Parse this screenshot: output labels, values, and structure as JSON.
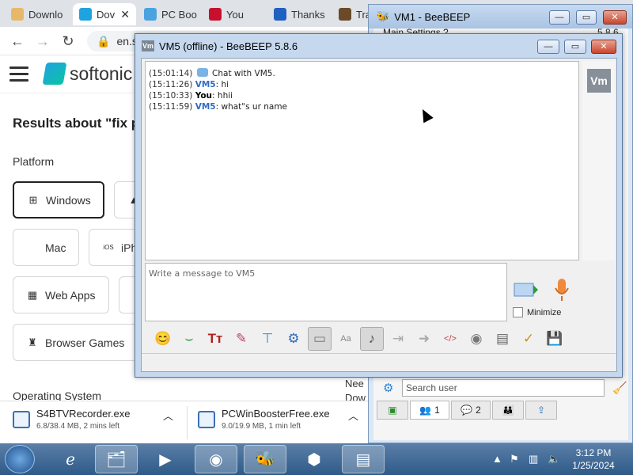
{
  "browser": {
    "tabs": [
      {
        "label": "Downlo",
        "icon": "softonic-icon",
        "color": "#e8b86a"
      },
      {
        "label": "Dov",
        "icon": "softonic-icon",
        "color": "#1fa3e0",
        "close": "✕"
      },
      {
        "label": "PC Boo",
        "icon": "pc-booster-icon",
        "color": "#4aa3df"
      },
      {
        "label": "You",
        "icon": "adobe-icon",
        "color": "#c8102e"
      },
      {
        "label": "Thanks",
        "icon": "thanks-icon",
        "color": "#2060c0"
      },
      {
        "label": "Tra",
        "icon": "game-icon",
        "color": "#6b4a2a"
      }
    ],
    "address": "en.so"
  },
  "page": {
    "brand": "softonic",
    "results_title": "Results about \"fix p",
    "platform_label": "Platform",
    "chips": [
      {
        "label": "Windows",
        "icon": "⊞"
      },
      {
        "label": "Mac",
        "icon": ""
      },
      {
        "label": "iPh",
        "icon": "iOS"
      },
      {
        "label": "Web Apps",
        "icon": "▦"
      },
      {
        "label": "Browser Games",
        "icon": "♜"
      }
    ],
    "os_label": "Operating System",
    "partial_text": [
      "Nee",
      "Dow"
    ]
  },
  "downloads": [
    {
      "name": "S4BTVRecorder.exe",
      "meta": "6.8/38.4 MB, 2 mins left"
    },
    {
      "name": "PCWinBoosterFree.exe",
      "meta": "9.0/19.9 MB, 1 min left"
    }
  ],
  "vm1": {
    "title": "VM1 - BeeBEEP",
    "search_placeholder": "Search user",
    "tabs": [
      {
        "label": "",
        "icon": "screen-icon"
      },
      {
        "label": "1",
        "icon": "users-icon"
      },
      {
        "label": "2",
        "icon": "chat-icon"
      },
      {
        "label": "",
        "icon": "groups-icon"
      },
      {
        "label": "",
        "icon": "share-icon"
      }
    ],
    "header_partial": "Main Settings ?",
    "version_partial": "5.8.6"
  },
  "vm5": {
    "title": "VM5 (offline) - BeeBEEP 5.8.6",
    "avatar": "Vm",
    "messages": [
      {
        "time": "(15:01:14)",
        "sender": "",
        "text": "Chat with VM5."
      },
      {
        "time": "(15:11:26)",
        "sender": "VM5",
        "text": "hi"
      },
      {
        "time": "(15:10:33)",
        "sender": "You",
        "text": "hhii"
      },
      {
        "time": "(15:11:59)",
        "sender": "VM5",
        "text": "what\"s ur name"
      }
    ],
    "input_placeholder": "Write a message to VM5",
    "minimize_label": "Minimize",
    "toolbar": [
      "😊",
      "⌣",
      "Tт",
      "✎",
      "⊤",
      "⚙",
      "▭",
      "Aa",
      "♪",
      "⇥",
      "➜",
      "</>",
      "◉",
      "▤",
      "✓",
      "💾"
    ]
  },
  "taskbar": {
    "clock_time": "3:12 PM",
    "clock_date": "1/25/2024"
  }
}
